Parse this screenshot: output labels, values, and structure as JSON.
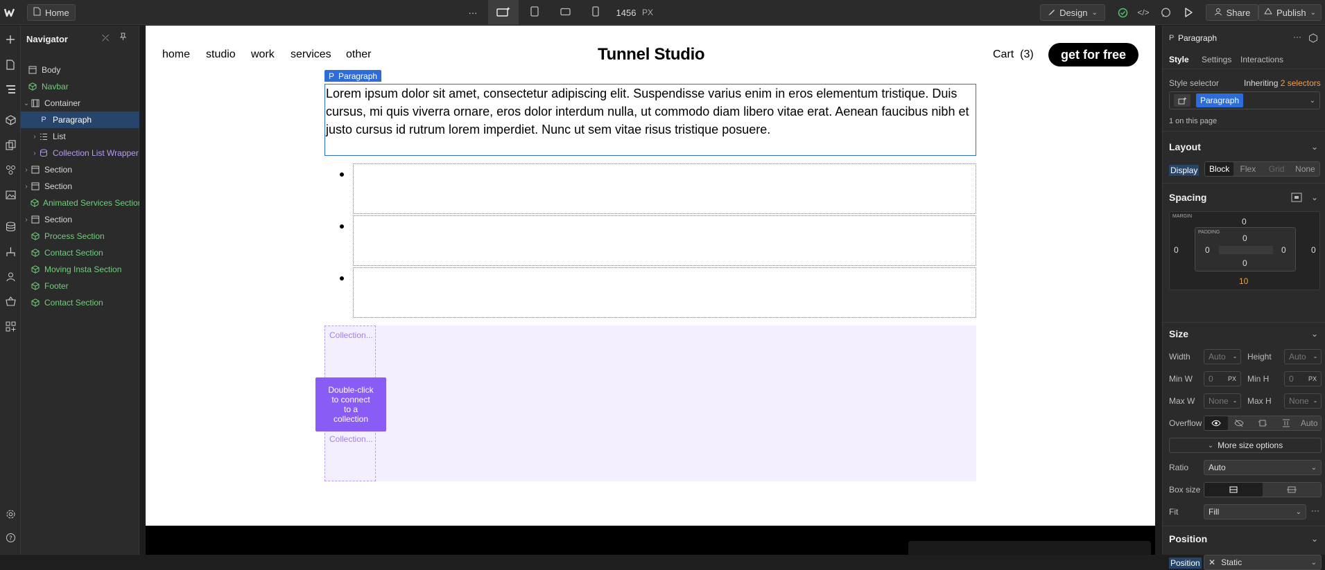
{
  "topbar": {
    "home_label": "Home",
    "more_label": "···",
    "width_value": "1456",
    "width_unit": "PX",
    "design_label": "Design",
    "share_label": "Share",
    "publish_label": "Publish"
  },
  "navigator": {
    "title": "Navigator",
    "items": [
      {
        "label": "Body"
      },
      {
        "label": "Navbar"
      },
      {
        "label": "Container"
      },
      {
        "label": "Paragraph"
      },
      {
        "label": "List"
      },
      {
        "label": "Collection List Wrapper"
      },
      {
        "label": "Section"
      },
      {
        "label": "Section"
      },
      {
        "label": "Animated Services Section"
      },
      {
        "label": "Section"
      },
      {
        "label": "Process Section"
      },
      {
        "label": "Contact Section"
      },
      {
        "label": "Moving Insta Section"
      },
      {
        "label": "Footer"
      },
      {
        "label": "Contact Section"
      }
    ]
  },
  "site": {
    "nav_links": [
      "home",
      "studio",
      "work",
      "services",
      "other"
    ],
    "brand": "Tunnel Studio",
    "cart_label": "Cart",
    "cart_count": "(3)",
    "cta_label": "get for free",
    "paragraph_tag": "Paragraph",
    "paragraph_text": "Lorem ipsum dolor sit amet, consectetur adipiscing elit. Suspendisse varius enim in eros elementum tristique. Duis cursus, mi quis viverra ornare, eros dolor interdum nulla, ut commodo diam libero vitae erat. Aenean faucibus nibh et justo cursus id rutrum lorem imperdiet. Nunc ut sem vitae risus tristique posuere.",
    "collection_tag": "Collection...",
    "connect_hint": "Double-click to connect to a collection"
  },
  "panel": {
    "element_name": "Paragraph",
    "tabs": [
      "Style",
      "Settings",
      "Interactions"
    ],
    "style_selector_label": "Style selector",
    "inheriting_label": "Inheriting",
    "inheriting_count": "2 selectors",
    "selector_chip": "Paragraph",
    "on_page": "1 on this page",
    "layout_title": "Layout",
    "display_label": "Display",
    "display_options": [
      "Block",
      "Flex",
      "Grid",
      "None"
    ],
    "spacing_title": "Spacing",
    "margin_label": "MARGIN",
    "padding_label": "PADDING",
    "margin": {
      "top": "0",
      "right": "0",
      "bottom": "10",
      "left": "0"
    },
    "padding": {
      "top": "0",
      "right": "0",
      "bottom": "0",
      "left": "0"
    },
    "size_title": "Size",
    "width_label": "Width",
    "width_value": "Auto",
    "height_label": "Height",
    "height_value": "Auto",
    "minw_label": "Min W",
    "minw_value": "0",
    "minh_label": "Min H",
    "minh_value": "0",
    "maxw_label": "Max W",
    "maxw_value": "None",
    "maxh_label": "Max H",
    "maxh_value": "None",
    "unit_dash": "-",
    "unit_px": "PX",
    "overflow_label": "Overflow",
    "overflow_auto": "Auto",
    "more_size_label": "More size options",
    "ratio_label": "Ratio",
    "ratio_value": "Auto",
    "boxsize_label": "Box size",
    "fit_label": "Fit",
    "fit_value": "Fill",
    "position_title": "Position",
    "position_label": "Position",
    "position_value": "Static"
  },
  "colors": {
    "accent": "#2c6cdb",
    "component": "#6fd07a",
    "collection": "#b99af5",
    "connect": "#8a5cf6",
    "warning": "#f0a24a"
  }
}
